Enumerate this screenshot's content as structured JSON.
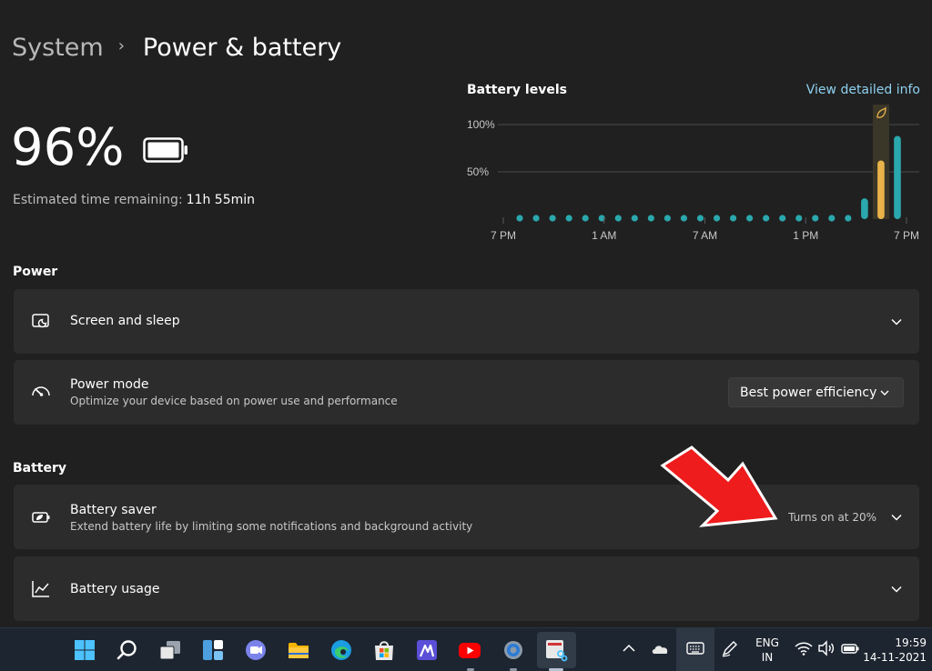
{
  "breadcrumb": {
    "parent": "System",
    "separator": "›",
    "current": "Power & battery"
  },
  "battery": {
    "percent": "96%",
    "estimate_label": "Estimated time remaining:",
    "estimate_value": "11h 55min"
  },
  "chart_header": {
    "title": "Battery levels",
    "link": "View detailed info"
  },
  "chart_data": {
    "type": "bar",
    "y_ticks": [
      "100%",
      "50%"
    ],
    "x_ticks": [
      "7 PM",
      "1 AM",
      "7 AM",
      "1 PM",
      "7 PM"
    ],
    "ylim": [
      0,
      100
    ],
    "bar_count": 24,
    "values": [
      0,
      0,
      0,
      0,
      0,
      0,
      0,
      0,
      0,
      0,
      0,
      0,
      0,
      0,
      0,
      0,
      0,
      0,
      0,
      0,
      0,
      22,
      62,
      88
    ],
    "highlight_index": 22,
    "colors": {
      "normal": "#2aa8ad",
      "highlight": "#e9b34a",
      "grid": "#4a4a4a",
      "baseline": "#5a5a5a"
    }
  },
  "power": {
    "section_title": "Power",
    "screen_sleep": {
      "title": "Screen and sleep"
    },
    "power_mode": {
      "title": "Power mode",
      "subtitle": "Optimize your device based on power use and performance",
      "selected": "Best power efficiency"
    }
  },
  "battery_section": {
    "section_title": "Battery",
    "saver": {
      "title": "Battery saver",
      "subtitle": "Extend battery life by limiting some notifications and background activity",
      "status": "Turns on at 20%"
    },
    "usage": {
      "title": "Battery usage"
    }
  },
  "taskbar": {
    "apps": [
      "start-icon",
      "search-icon",
      "task-view-icon",
      "widgets-icon",
      "teams-chat-icon",
      "file-explorer-icon",
      "edge-icon",
      "store-icon",
      "vscode-icon",
      "youtube-icon",
      "settings-icon",
      "snipping-tool-icon"
    ],
    "lang_line1": "ENG",
    "lang_line2": "IN",
    "time": "19:59",
    "date": "14-11-2021"
  },
  "colors": {
    "accent": "#8fd1f0",
    "background": "#202020",
    "card": "#2c2c2c",
    "arrow": "#ee1c1c"
  }
}
